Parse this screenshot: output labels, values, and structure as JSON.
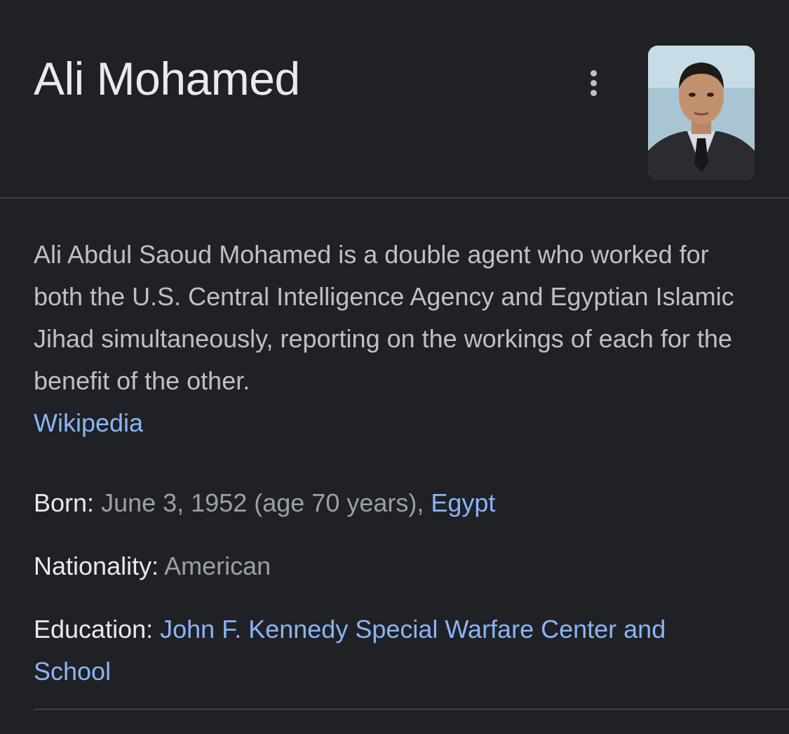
{
  "header": {
    "title": "Ali Mohamed"
  },
  "description": {
    "text": "Ali Abdul Saoud Mohamed is a double agent who worked for both the U.S. Central Intelligence Agency and Egyptian Islamic Jihad simultaneously, reporting on the workings of each for the benefit of the other.",
    "source_link": "Wikipedia"
  },
  "facts": {
    "born": {
      "label": "Born:",
      "value": "June 3, 1952 (age 70 years), ",
      "link": "Egypt"
    },
    "nationality": {
      "label": "Nationality:",
      "value": "American"
    },
    "education": {
      "label": "Education:",
      "link": "John F. Kennedy Special Warfare Center and School"
    }
  },
  "colors": {
    "background": "#202124",
    "title": "#e8eaed",
    "body_text": "#bdc1c6",
    "muted_value": "#9aa0a6",
    "link": "#8ab4f8",
    "divider": "#3c4043"
  },
  "icons": {
    "more": "more-vert-icon"
  }
}
